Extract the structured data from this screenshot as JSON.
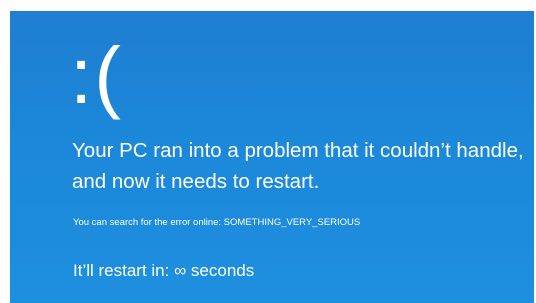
{
  "screen": {
    "background": "#1b88d9",
    "text_color": "#ffffff",
    "emoticon": ":(",
    "headline": "Your PC ran into a problem that it couldn’t handle, and now it needs to restart.",
    "search_info": "You can search for the error online: SOMETHING_VERY_SERIOUS",
    "restart_message": "It’ll restart in: ∞ seconds"
  }
}
